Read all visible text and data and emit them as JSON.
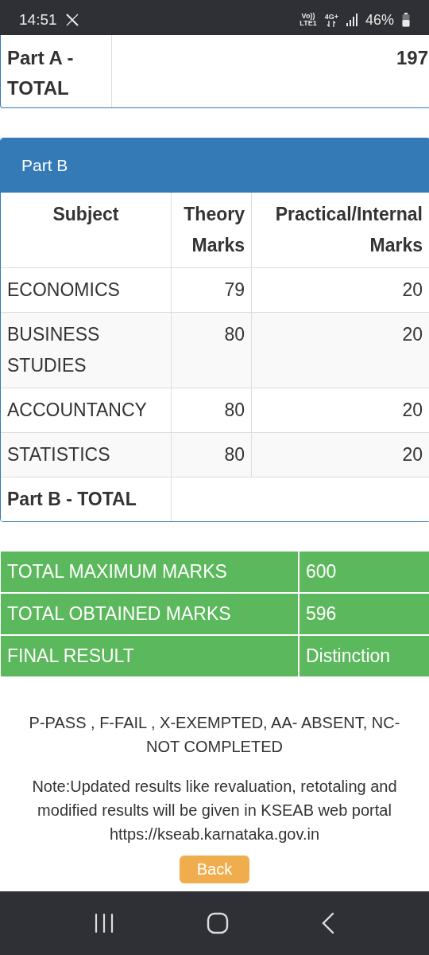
{
  "status_bar": {
    "time": "14:51",
    "volte_top": "Vo))",
    "volte_bottom": "LTE1",
    "data_type": "4G+",
    "battery": "46%"
  },
  "part_a_total": {
    "label": "Part A - TOTAL",
    "value": "197"
  },
  "part_b": {
    "title": "Part B",
    "columns": [
      "Subject",
      "Theory Marks",
      "Practical/Internal Marks"
    ],
    "rows": [
      {
        "subject": "ECONOMICS",
        "theory": "79",
        "practical": "20"
      },
      {
        "subject": "BUSINESS STUDIES",
        "theory": "80",
        "practical": "20"
      },
      {
        "subject": "ACCOUNTANCY",
        "theory": "80",
        "practical": "20"
      },
      {
        "subject": "STATISTICS",
        "theory": "80",
        "practical": "20"
      }
    ],
    "total_label": "Part B - TOTAL"
  },
  "summary": [
    {
      "label": "TOTAL MAXIMUM MARKS",
      "value": "600"
    },
    {
      "label": "TOTAL OBTAINED MARKS",
      "value": "596"
    },
    {
      "label": "FINAL RESULT",
      "value": "Distinction"
    }
  ],
  "legend": "P-PASS , F-FAIL , X-EXEMPTED, AA- ABSENT, NC-NOT COMPLETED",
  "note": "Note:Updated results like revaluation, retotaling and modified results will be given in KSEAB web portal https://kseab.karnataka.gov.in",
  "back_button": "Back"
}
